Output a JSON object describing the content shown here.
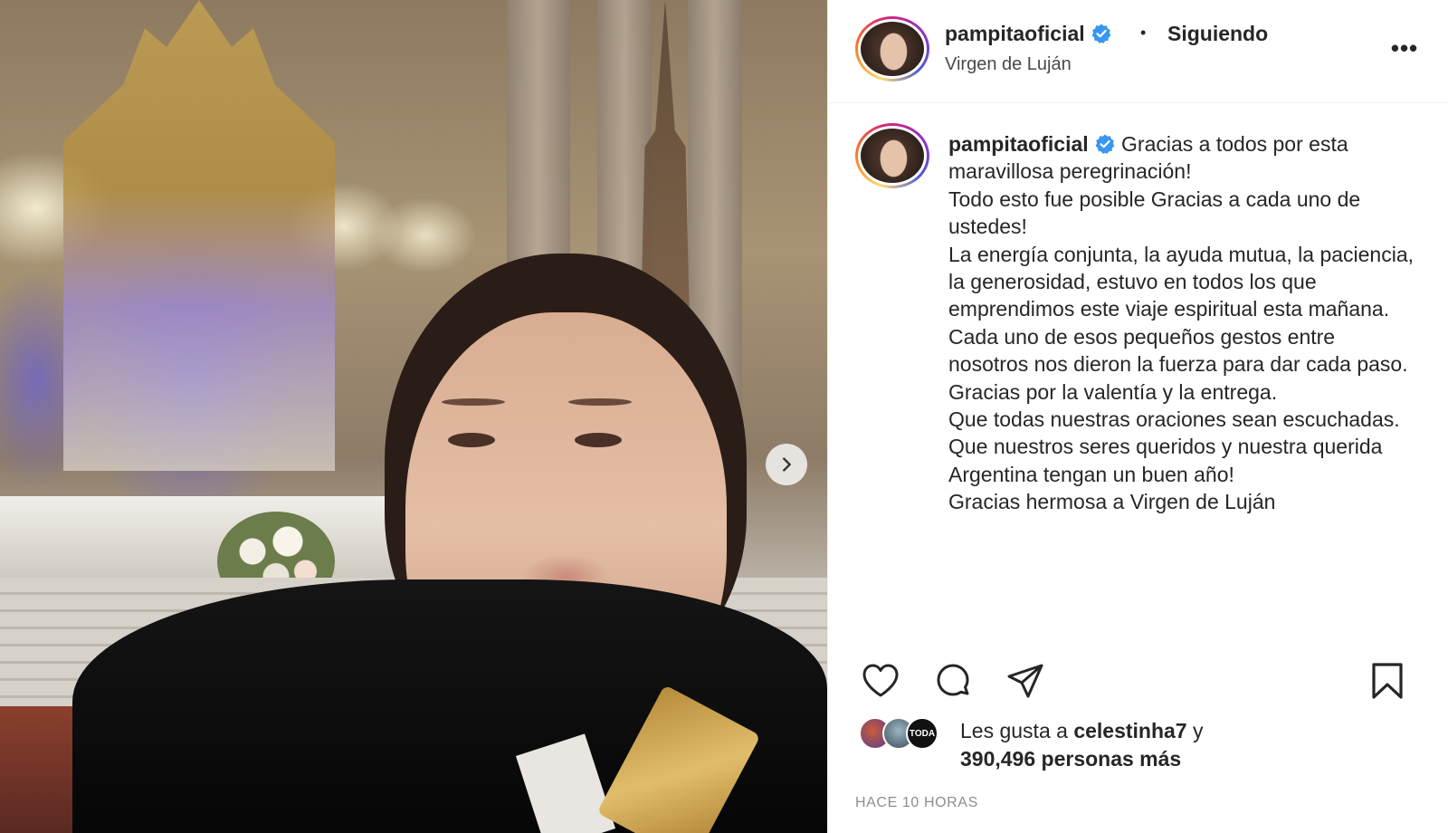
{
  "post": {
    "username": "pampitaoficial",
    "verified": true,
    "follow_status": "Siguiendo",
    "separator": "•",
    "location": "Virgen de Luján",
    "more_label": "•••",
    "caption": {
      "username": "pampitaoficial",
      "lines": [
        "Gracias a todos por esta maravillosa peregrinación!",
        "Todo esto fue posible Gracias a cada uno de ustedes!",
        "La energía conjunta, la ayuda mutua, la paciencia, la generosidad, estuvo en todos los que emprendimos este viaje espiritual esta mañana.",
        "Cada uno de esos pequeños gestos entre nosotros nos dieron la fuerza para dar cada paso.",
        "Gracias por la valentía y la entrega.",
        "Que todas nuestras oraciones sean escuchadas.",
        "Que nuestros seres queridos y nuestra querida Argentina tengan un buen año!",
        "Gracias hermosa a Virgen de Luján"
      ]
    },
    "likes": {
      "prefix": "Les gusta a",
      "first_user": "celestinha7",
      "conjunction": "y",
      "count_text": "390,496 personas más",
      "mini_avatar_label": "TODA"
    },
    "timestamp": "HACE 10 HORAS"
  },
  "colors": {
    "verified": "#3897f0",
    "text": "#262626",
    "muted": "#8e8e8e"
  },
  "icons": {
    "next": "chevron-right-icon",
    "like": "heart-icon",
    "comment": "comment-bubble-icon",
    "share": "paper-plane-icon",
    "save": "bookmark-icon",
    "more": "more-options-icon",
    "verified": "verified-badge-icon"
  }
}
